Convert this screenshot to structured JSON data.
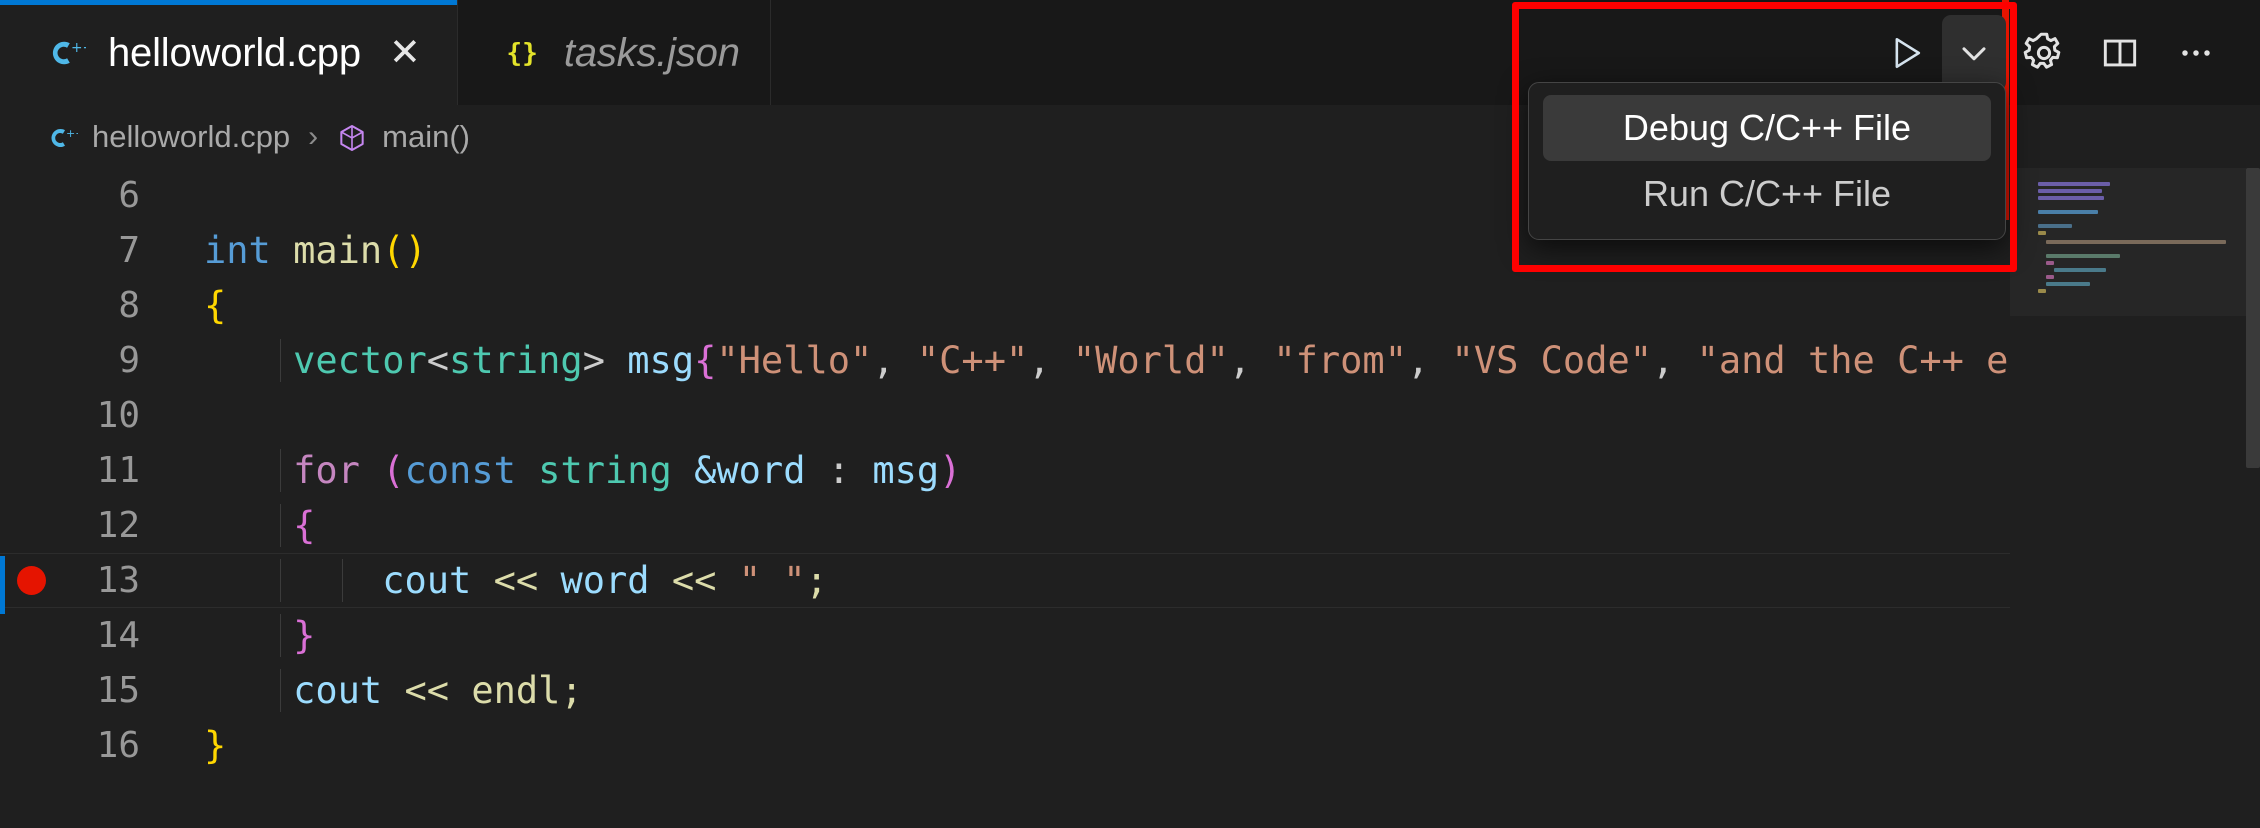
{
  "window": {
    "app": "Visual Studio Code",
    "theme_bg": "#1f1f1f",
    "accent": "#0078d4"
  },
  "tabs": [
    {
      "label": "helloworld.cpp",
      "icon": "cpp-file-icon",
      "active": true,
      "dirty": false,
      "close_label": "✕"
    },
    {
      "label": "tasks.json",
      "icon": "json-file-icon",
      "active": false,
      "preview": true
    }
  ],
  "editor_actions": [
    {
      "name": "run-c-cpp-file-button",
      "icon": "play-icon",
      "label": "Run C/C++ File",
      "active": false
    },
    {
      "name": "run-options-dropdown-button",
      "icon": "chevron-down-icon",
      "label": "Run or Debug...",
      "active": true
    },
    {
      "name": "settings-gear-button",
      "icon": "gear-icon",
      "label": "Settings",
      "active": false
    },
    {
      "name": "split-editor-button",
      "icon": "split-editor-icon",
      "label": "Split Editor Right",
      "active": false
    },
    {
      "name": "more-actions-button",
      "icon": "ellipsis-icon",
      "label": "More Actions...",
      "active": false
    }
  ],
  "breadcrumb": {
    "file_icon": "cpp-file-icon",
    "file": "helloworld.cpp",
    "separator": "›",
    "symbol_icon": "method-symbol-icon",
    "symbol": "main()"
  },
  "dropdown": {
    "visible": true,
    "items": [
      {
        "label": "Debug C/C++ File",
        "selected": true
      },
      {
        "label": "Run C/C++ File",
        "selected": false
      }
    ]
  },
  "annotation": {
    "type": "red-highlight-rectangle",
    "color": "#ff0000"
  },
  "code": {
    "language": "cpp",
    "first_visible_line": 6,
    "last_visible_line": 16,
    "breakpoint_lines": [
      13
    ],
    "current_line": 13,
    "lines": [
      {
        "n": "6",
        "text": ""
      },
      {
        "n": "7",
        "text": "int main()"
      },
      {
        "n": "8",
        "text": "{"
      },
      {
        "n": "9",
        "text": "    vector<string> msg{\"Hello\", \"C++\", \"World\", \"from\", \"VS Code\", \"and the C++ ext"
      },
      {
        "n": "10",
        "text": ""
      },
      {
        "n": "11",
        "text": "    for (const string &word : msg)"
      },
      {
        "n": "12",
        "text": "    {"
      },
      {
        "n": "13",
        "text": "        cout << word << \" \";"
      },
      {
        "n": "14",
        "text": "    }"
      },
      {
        "n": "15",
        "text": "    cout << endl;"
      },
      {
        "n": "16",
        "text": "}"
      }
    ]
  },
  "minimap": {
    "visible": true,
    "overview_marker_color": "#e51400"
  },
  "colors": {
    "keyword_blue": "#569cd6",
    "control_pink": "#c586c0",
    "type_green": "#4ec9b0",
    "variable_lightblue": "#9cdcfe",
    "function_yellow": "#dcdcaa",
    "string_orange": "#ce9178",
    "bracket_magenta": "#da70d6",
    "bracket_gold": "#ffd700",
    "breakpoint_red": "#e51400",
    "tab_active_border": "#0078d4"
  }
}
